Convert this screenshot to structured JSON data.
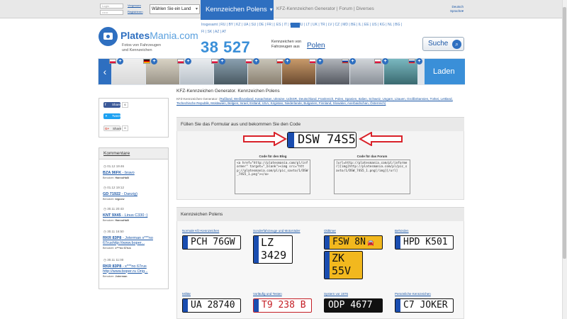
{
  "topbar": {
    "login_placeholder": "Login",
    "password_placeholder": "••••••",
    "remember": "Vergessen",
    "register": "Registrieren",
    "country_select": "Wählen Sie ein Land",
    "active_menu": "Kennzeichen Polens",
    "nav": [
      "KFZ-Kennzeichen Generator",
      "Forum",
      "Diverses"
    ],
    "lang": "Deutsch",
    "lang_sub": "Sprache"
  },
  "logo": {
    "name_plates": "Plates",
    "name_mania": "Mania.com",
    "tagline1": "Fotos von Fahrzeugen",
    "tagline2": "und Kennzeichen"
  },
  "countries_line1": "Insgesamt | RU | BY | KZ | UA | SU | DE | FR |      | ES | IT | CH | HU | LT | UK | TR | LV | CZ | MD | BE | IL | EE | US | KG | NL | BG |",
  "countries_line2": "FI | SK | AZ | AT",
  "stats": {
    "count": "38 527",
    "label1": "Kennzeichen von",
    "label2": "Fahrzeugen aus",
    "country": "Polen"
  },
  "search_button": "Suche",
  "load_button": "Laden",
  "social": {
    "facebook": "Share",
    "facebook_count": "6",
    "twitter": "Tweet",
    "google": "Share",
    "google_count": "0"
  },
  "comments": {
    "title": "Kommentare",
    "items": [
      {
        "date": "01.12 19:46",
        "plate": "BZA 96FK",
        "text": " - bravo",
        "by_label": "Benutzer:",
        "by": "HannoHalli"
      },
      {
        "date": "01.12 19:12",
        "plate": "GD 71922",
        "text": " - Danzig)",
        "by_label": "Benutzer:",
        "by": "bigcow"
      },
      {
        "date": "30.11 20:43",
        "plate": "KNT 9X45",
        "text": " - Linus C330 :)",
        "by_label": "Benutzer:",
        "by": "HannoHalli"
      },
      {
        "date": "30.11 16:50",
        "plate": "RKR 83P8",
        "text": " - Joterman x***no 67rushttp://www.boper...",
        "by_label": "Benutzer:",
        "by": "x***no 67rus"
      },
      {
        "date": "30.11 11:00",
        "plate": "RKR 83P8",
        "text": " - x***no 67rus http://www.boper.ru Orig...",
        "by_label": "Benutzer:",
        "by": "Joterman"
      }
    ]
  },
  "breadcrumb": "KFZ-Kennzeichen Generator. Kennzeichen Polens",
  "generator_links_intro": "KFZ-Kennzeichen Generator: (",
  "generator_links": "Rußland, Weißrussland, Kasachstan, Ukraine, UdSSR, Deutschland, Frankreich, Polen, Spanien, Italien, Schweiz, Ungarn, Litauen, Großbritannien, Türkei, Lettland, Tschechische Republik, Moldawien, Belgien, Israel, Estland, USA, Kirgistan, Niederlande, Bulgarien, Finnland, Slowakei, Aserbaidschan, Österreich)",
  "form": {
    "header": "Füllen Sie das Formular aus und bekommen Sie den Code",
    "plate": "DSW 74S5",
    "blog_label": "Code für den Blog",
    "blog_code": "<a href=\"http://platesmania.com/pl/informer\" target=\"_blank\"><img src=\"http://platesmania.com/pl/pic_savto/1/DSW_74S5_1.png\"></a>",
    "forum_label": "Code für das Forum",
    "forum_code": "[url=http://platesmania.com/pl/informer][img]http://platesmania.com/pl/pic_savto/1/DSW_74S5_1.png[/img][/url]"
  },
  "plates_section": {
    "header": "Kennzeichen Polens",
    "types": [
      {
        "label": "Normale Kfz-Kennzeichen",
        "plate": "PCH 76GW"
      },
      {
        "label": "Sonderfahrzeuge und Motorräder",
        "plate": "LZ 3429"
      },
      {
        "label": "Oldtimer",
        "plate": "FSW 8N"
      },
      {
        "label": "Behörden",
        "plate": "HPD K501"
      },
      {
        "label": "",
        "plate": "ZK 55V"
      },
      {
        "label": "Militär",
        "plate": "UA 28740"
      },
      {
        "label": "Vorläufig und Testen",
        "plate": "T9 238 B"
      },
      {
        "label": "Systern vor 1976",
        "plate": "ODP 4677"
      },
      {
        "label": "Persönliche Kennzeichen",
        "plate": "C7 JOKER"
      }
    ]
  },
  "colors": {
    "accent": "#2e6fc0",
    "link": "#1a56a6",
    "arrow": "#d9222a",
    "oldtimer_yellow": "#f2b81e",
    "temp_red": "#c41e25",
    "vintage_black": "#111111"
  }
}
